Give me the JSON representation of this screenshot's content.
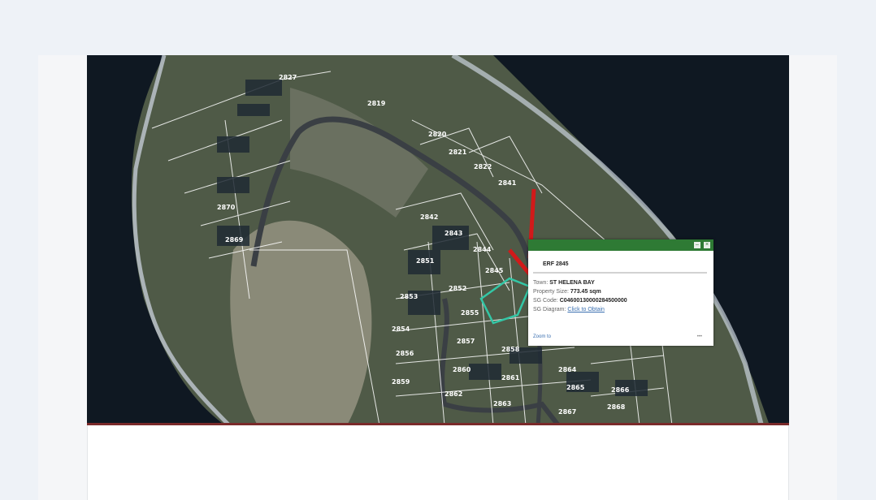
{
  "map": {
    "plots": [
      "2827",
      "2819",
      "2820",
      "2821",
      "2822",
      "2841",
      "2842",
      "2843",
      "2844",
      "2845",
      "2851",
      "2852",
      "2853",
      "2854",
      "2855",
      "2856",
      "2857",
      "2858",
      "2859",
      "2860",
      "2861",
      "2862",
      "2863",
      "2864",
      "2865",
      "2866",
      "2867",
      "2868",
      "2869",
      "2870"
    ],
    "colors": {
      "ocean": "#0f1822",
      "land": "#5a6650",
      "road": "#3a3f44",
      "boundary": "#ffffff",
      "arrow": "#d11a1a",
      "popup_bar": "#2e7a34",
      "selected_parcel": "#33c7a6"
    }
  },
  "popup": {
    "title": "ERF 2845",
    "rows": [
      {
        "label": "Town:",
        "value": "ST HELENA BAY"
      },
      {
        "label": "Property Size:",
        "value": "773.45 sqm"
      },
      {
        "label": "SG Code:",
        "value": "C04600130000284500000"
      },
      {
        "label": "SG Diagram:",
        "value": "Click to Obtain"
      }
    ],
    "zoom_link": "Zoom to",
    "more": "•••",
    "minimize_icon": "–",
    "close_icon": "×"
  }
}
